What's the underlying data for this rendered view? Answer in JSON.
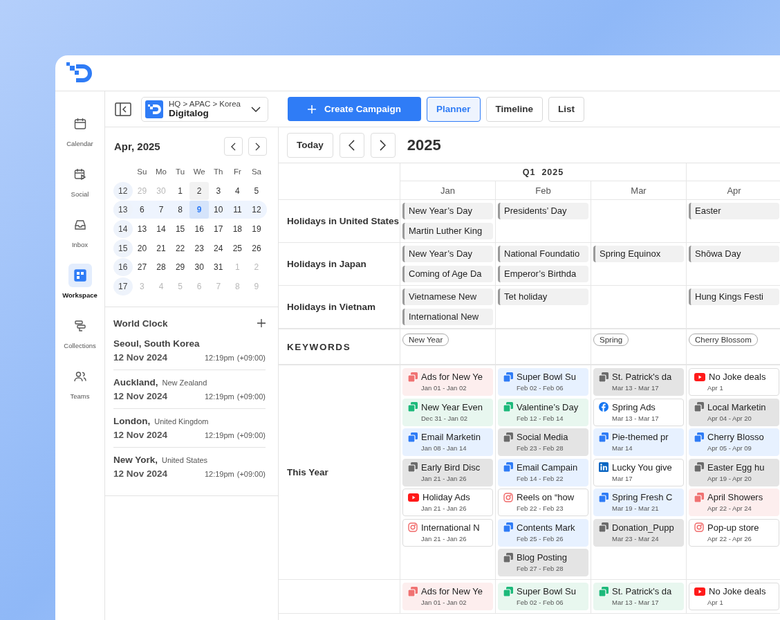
{
  "rail": {
    "items": [
      {
        "label": "Calendar",
        "selected": false
      },
      {
        "label": "Social",
        "selected": false
      },
      {
        "label": "Inbox",
        "selected": false
      },
      {
        "label": "Workspace",
        "selected": true
      },
      {
        "label": "Collections",
        "selected": false
      },
      {
        "label": "Teams",
        "selected": false
      }
    ]
  },
  "org_selector": {
    "path": "HQ > APAC > Korea",
    "name": "Digitalog"
  },
  "toolbar": {
    "create_button": "Create Campaign",
    "views": [
      {
        "label": "Planner",
        "selected": true
      },
      {
        "label": "Timeline",
        "selected": false
      },
      {
        "label": "List",
        "selected": false
      }
    ]
  },
  "mini_calendar": {
    "title": "Apr, 2025",
    "weekdays": [
      "Su",
      "Mo",
      "Tu",
      "We",
      "Th",
      "Fr",
      "Sa"
    ],
    "weeks": [
      {
        "week": "12",
        "selected": false,
        "days": [
          {
            "label": "29",
            "muted": true,
            "selected": false,
            "hovered": false
          },
          {
            "label": "30",
            "muted": true,
            "selected": false,
            "hovered": false
          },
          {
            "label": "1",
            "muted": false,
            "selected": false,
            "hovered": false
          },
          {
            "label": "2",
            "muted": false,
            "selected": false,
            "hovered": true
          },
          {
            "label": "3",
            "muted": false,
            "selected": false,
            "hovered": false
          },
          {
            "label": "4",
            "muted": false,
            "selected": false,
            "hovered": false
          },
          {
            "label": "5",
            "muted": false,
            "selected": false,
            "hovered": false
          }
        ]
      },
      {
        "week": "13",
        "selected": true,
        "days": [
          {
            "label": "6",
            "muted": false,
            "selected": false,
            "hovered": false
          },
          {
            "label": "7",
            "muted": false,
            "selected": false,
            "hovered": false
          },
          {
            "label": "8",
            "muted": false,
            "selected": false,
            "hovered": false
          },
          {
            "label": "9",
            "muted": false,
            "selected": true,
            "hovered": false
          },
          {
            "label": "10",
            "muted": false,
            "selected": false,
            "hovered": false
          },
          {
            "label": "11",
            "muted": false,
            "selected": false,
            "hovered": false
          },
          {
            "label": "12",
            "muted": false,
            "selected": false,
            "hovered": false
          }
        ]
      },
      {
        "week": "14",
        "selected": false,
        "days": [
          {
            "label": "13",
            "muted": false,
            "selected": false,
            "hovered": false
          },
          {
            "label": "14",
            "muted": false,
            "selected": false,
            "hovered": false
          },
          {
            "label": "15",
            "muted": false,
            "selected": false,
            "hovered": false
          },
          {
            "label": "16",
            "muted": false,
            "selected": false,
            "hovered": false
          },
          {
            "label": "17",
            "muted": false,
            "selected": false,
            "hovered": false
          },
          {
            "label": "18",
            "muted": false,
            "selected": false,
            "hovered": false
          },
          {
            "label": "19",
            "muted": false,
            "selected": false,
            "hovered": false
          }
        ]
      },
      {
        "week": "15",
        "selected": false,
        "days": [
          {
            "label": "20",
            "muted": false,
            "selected": false,
            "hovered": false
          },
          {
            "label": "21",
            "muted": false,
            "selected": false,
            "hovered": false
          },
          {
            "label": "22",
            "muted": false,
            "selected": false,
            "hovered": false
          },
          {
            "label": "23",
            "muted": false,
            "selected": false,
            "hovered": false
          },
          {
            "label": "24",
            "muted": false,
            "selected": false,
            "hovered": false
          },
          {
            "label": "25",
            "muted": false,
            "selected": false,
            "hovered": false
          },
          {
            "label": "26",
            "muted": false,
            "selected": false,
            "hovered": false
          }
        ]
      },
      {
        "week": "16",
        "selected": false,
        "days": [
          {
            "label": "27",
            "muted": false,
            "selected": false,
            "hovered": false
          },
          {
            "label": "28",
            "muted": false,
            "selected": false,
            "hovered": false
          },
          {
            "label": "29",
            "muted": false,
            "selected": false,
            "hovered": false
          },
          {
            "label": "30",
            "muted": false,
            "selected": false,
            "hovered": false
          },
          {
            "label": "31",
            "muted": false,
            "selected": false,
            "hovered": false
          },
          {
            "label": "1",
            "muted": true,
            "selected": false,
            "hovered": false
          },
          {
            "label": "2",
            "muted": true,
            "selected": false,
            "hovered": false
          }
        ]
      },
      {
        "week": "17",
        "selected": false,
        "days": [
          {
            "label": "3",
            "muted": true,
            "selected": false,
            "hovered": false
          },
          {
            "label": "4",
            "muted": true,
            "selected": false,
            "hovered": false
          },
          {
            "label": "5",
            "muted": true,
            "selected": false,
            "hovered": false
          },
          {
            "label": "6",
            "muted": true,
            "selected": false,
            "hovered": false
          },
          {
            "label": "7",
            "muted": true,
            "selected": false,
            "hovered": false
          },
          {
            "label": "8",
            "muted": true,
            "selected": false,
            "hovered": false
          },
          {
            "label": "9",
            "muted": true,
            "selected": false,
            "hovered": false
          }
        ]
      }
    ]
  },
  "world_clock": {
    "title": "World Clock",
    "clocks": [
      {
        "city": "Seoul, South Korea",
        "date": "12 Nov 2024",
        "time": "12:19pm",
        "offset": "(+09:00)"
      },
      {
        "city": "Auckland,",
        "country": "New Zealand",
        "date": "12 Nov 2024",
        "time": "12:19pm",
        "offset": "(+09:00)"
      },
      {
        "city": "London,",
        "country": "United Kingdom",
        "date": "12 Nov 2024",
        "time": "12:19pm",
        "offset": "(+09:00)"
      },
      {
        "city": "New York,",
        "country": "United States",
        "date": "12 Nov 2024",
        "time": "12:19pm",
        "offset": "(+09:00)"
      }
    ]
  },
  "planner": {
    "today_button": "Today",
    "year": "2025",
    "quarter": "Q1  2025",
    "months": [
      "Jan",
      "Feb",
      "Mar",
      "Apr"
    ],
    "holiday_rows": [
      {
        "label": "Holidays in United States",
        "cells": [
          [
            "New Year’s Day",
            "Martin Luther King"
          ],
          [
            "Presidents’ Day"
          ],
          [],
          [
            "Easter"
          ]
        ]
      },
      {
        "label": "Holidays in Japan",
        "cells": [
          [
            "New Year’s Day",
            "Coming of Age Da"
          ],
          [
            "National Foundatio",
            "Emperor’s Birthda"
          ],
          [
            "Spring Equinox"
          ],
          [
            "Shōwa Day"
          ]
        ]
      },
      {
        "label": "Holidays in Vietnam",
        "cells": [
          [
            "Vietnamese New",
            "International New"
          ],
          [
            "Tet holiday"
          ],
          [],
          [
            "Hung Kings Festi"
          ]
        ]
      }
    ],
    "keywords_row": {
      "label": "KEYWORDS",
      "cells": [
        [
          "New Year"
        ],
        [],
        [
          "Spring"
        ],
        [
          "Cherry Blossom"
        ]
      ]
    },
    "campaign_rows": [
      {
        "label": "This Year",
        "cells": [
          [
            {
              "title": "Ads for New Ye",
              "dates": "Jan 01 - Jan 02",
              "kind": "red"
            },
            {
              "title": "New Year Even",
              "dates": "Dec 31 - Jan 02",
              "kind": "green"
            },
            {
              "title": "Email Marketin",
              "dates": "Jan 08 - Jan 14",
              "kind": "blue"
            },
            {
              "title": "Early Bird Disc",
              "dates": "Jan 21 - Jan 26",
              "kind": "grey"
            },
            {
              "title": "Holiday Ads",
              "dates": "Jan 21 - Jan 26",
              "kind": "youtube"
            },
            {
              "title": "International N",
              "dates": "Jan 21 - Jan 26",
              "kind": "instagram"
            }
          ],
          [
            {
              "title": "Super Bowl Su",
              "dates": "Feb 02 - Feb 06",
              "kind": "blue"
            },
            {
              "title": "Valentine’s Day",
              "dates": "Feb 12 - Feb 14",
              "kind": "green"
            },
            {
              "title": "Social Media",
              "dates": "Feb 23 - Feb 28",
              "kind": "grey"
            },
            {
              "title": "Email Campain",
              "dates": "Feb 14 - Feb 22",
              "kind": "blue"
            },
            {
              "title": "Reels on “how",
              "dates": "Feb 22 - Feb 23",
              "kind": "instagram"
            },
            {
              "title": "Contents Mark",
              "dates": "Feb 25 - Feb 26",
              "kind": "blue"
            },
            {
              "title": "Blog Posting",
              "dates": "Feb 27 - Feb 28",
              "kind": "grey"
            }
          ],
          [
            {
              "title": "St. Patrick's da",
              "dates": "Mar 13 - Mar 17",
              "kind": "grey"
            },
            {
              "title": "Spring Ads",
              "dates": "Mar 13 - Mar 17",
              "kind": "facebook"
            },
            {
              "title": "Pie-themed pr",
              "dates": "Mar 14",
              "kind": "blue"
            },
            {
              "title": "Lucky You give",
              "dates": "Mar 17",
              "kind": "linkedin"
            },
            {
              "title": "Spring Fresh C",
              "dates": "Mar 19 - Mar 21",
              "kind": "blue"
            },
            {
              "title": "Donation_Pupp",
              "dates": "Mar 23 - Mar 24",
              "kind": "grey"
            }
          ],
          [
            {
              "title": "No Joke deals",
              "dates": "Apr 1",
              "kind": "youtube"
            },
            {
              "title": "Local Marketin",
              "dates": "Apr 04 - Apr 20",
              "kind": "grey"
            },
            {
              "title": "Cherry Blosso",
              "dates": "Apr 05 - Apr 09",
              "kind": "blue"
            },
            {
              "title": "Easter Egg hu",
              "dates": "Apr 19 - Apr 20",
              "kind": "grey"
            },
            {
              "title": "April Showers",
              "dates": "Apr 22 - Apr 24",
              "kind": "red"
            },
            {
              "title": "Pop-up store",
              "dates": "Apr 22 - Apr 26",
              "kind": "instagram"
            }
          ]
        ]
      },
      {
        "cells": [
          [
            {
              "title": "Ads for New Ye",
              "dates": "Jan 01 - Jan 02",
              "kind": "red"
            }
          ],
          [
            {
              "title": "Super Bowl Su",
              "dates": "Feb 02 - Feb 06",
              "kind": "green"
            }
          ],
          [
            {
              "title": "St. Patrick's da",
              "dates": "Mar 13 - Mar 17",
              "kind": "green"
            }
          ],
          [
            {
              "title": "No Joke deals",
              "dates": "Apr 1",
              "kind": "youtube"
            }
          ]
        ]
      }
    ]
  }
}
